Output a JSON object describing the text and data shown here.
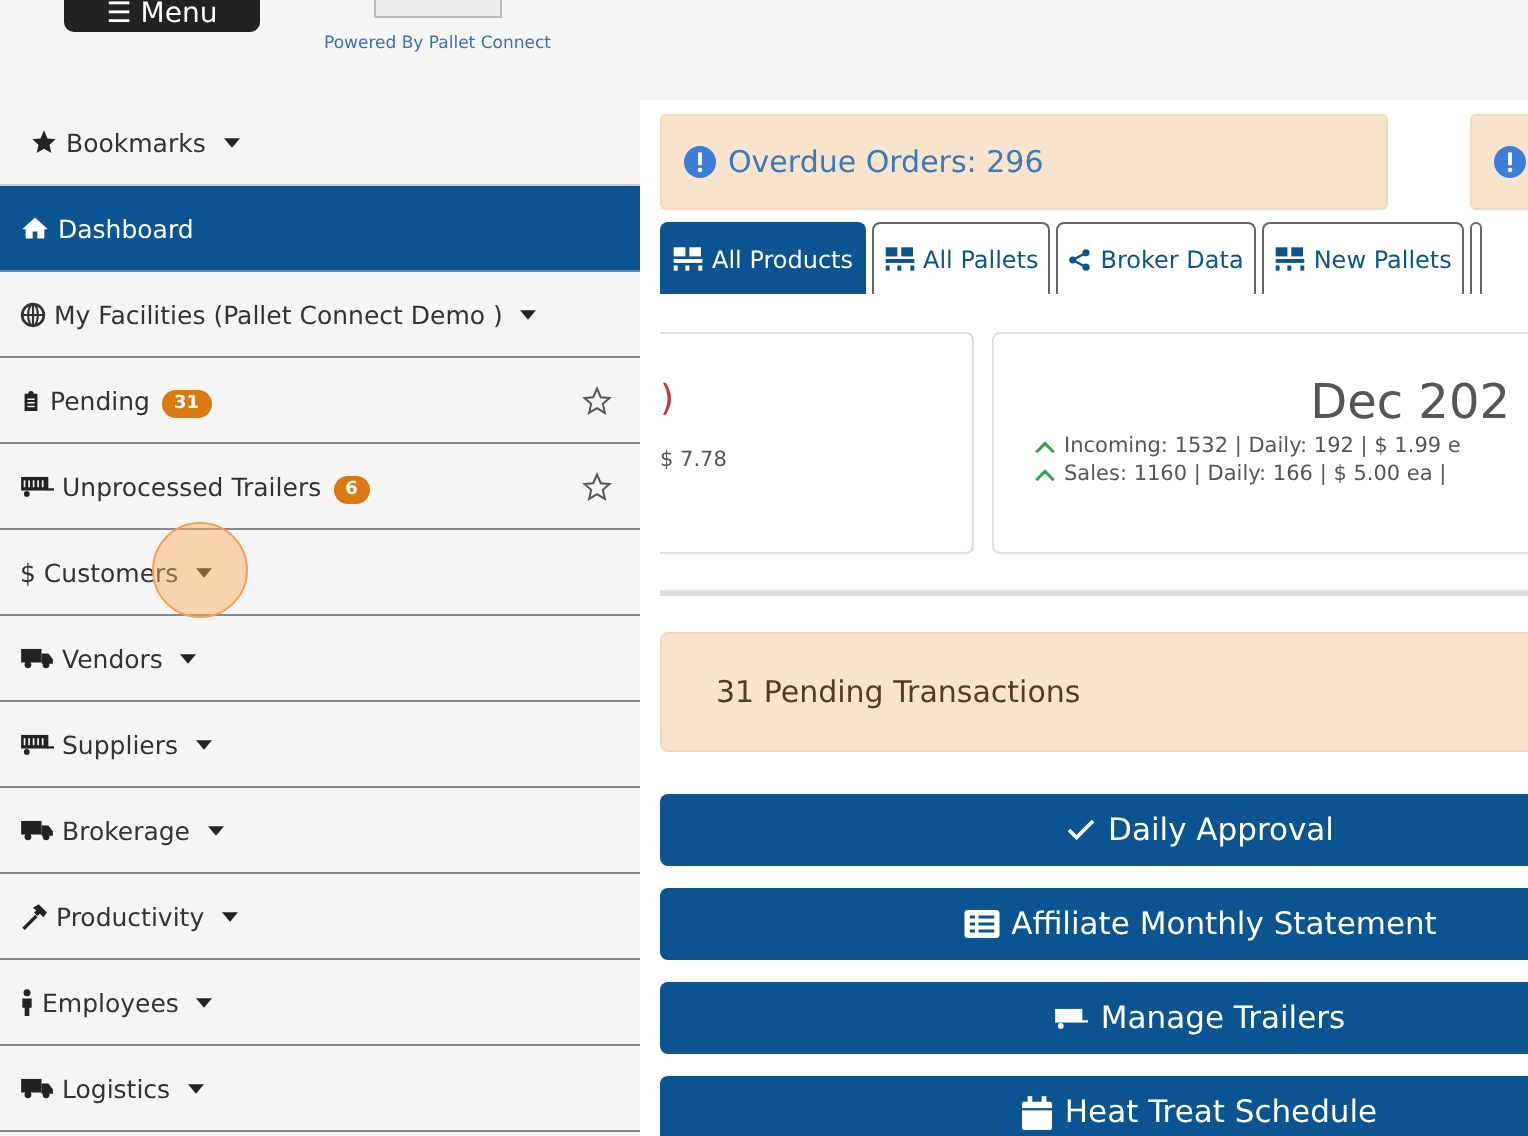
{
  "header": {
    "menu_button": "☰ Menu",
    "powered_by": "Powered By Pallet Connect"
  },
  "sidebar": {
    "items": [
      {
        "label": "Bookmarks",
        "selected": false,
        "dropdown": true
      },
      {
        "label": "Dashboard",
        "selected": true,
        "dropdown": false
      },
      {
        "label": "My Facilities (Pallet Connect Demo )",
        "selected": false,
        "dropdown": true
      },
      {
        "label": "Pending",
        "selected": false,
        "dropdown": false,
        "badge": "31",
        "starred": false
      },
      {
        "label": "Unprocessed Trailers",
        "selected": false,
        "dropdown": false,
        "badge": "6",
        "starred": false
      },
      {
        "label": "$ Customers",
        "selected": false,
        "dropdown": true
      },
      {
        "label": "Vendors",
        "selected": false,
        "dropdown": true
      },
      {
        "label": "Suppliers",
        "selected": false,
        "dropdown": true
      },
      {
        "label": "Brokerage",
        "selected": false,
        "dropdown": true
      },
      {
        "label": "Productivity",
        "selected": false,
        "dropdown": true
      },
      {
        "label": "Employees",
        "selected": false,
        "dropdown": true
      },
      {
        "label": "Logistics",
        "selected": false,
        "dropdown": true
      }
    ]
  },
  "alerts": [
    {
      "kind": "info",
      "text": "Overdue Orders: 296"
    },
    {
      "kind": "info"
    }
  ],
  "tabs": [
    {
      "label": "All Products",
      "selected": true
    },
    {
      "label": "All Pallets",
      "selected": false
    },
    {
      "label": "Broker Data",
      "selected": false
    },
    {
      "label": "New Pallets",
      "selected": false
    }
  ],
  "cards": [
    {
      "title": ")",
      "lines": [
        {
          "text": "$ 7.78"
        }
      ]
    },
    {
      "title": "Dec 202",
      "lines": [
        {
          "kind": "increase",
          "text": "Incoming: 1532 | Daily: 192 | $ 1.99 e"
        },
        {
          "kind": "increase",
          "text": "Sales: 1160 | Daily: 166 | $ 5.00 ea |"
        }
      ]
    }
  ],
  "pending_notice": "31 Pending Transactions",
  "actions": [
    {
      "label": "Daily Approval"
    },
    {
      "label": "Affiliate Monthly Statement"
    },
    {
      "label": "Manage Trailers"
    },
    {
      "label": "Heat Treat Schedule"
    }
  ]
}
